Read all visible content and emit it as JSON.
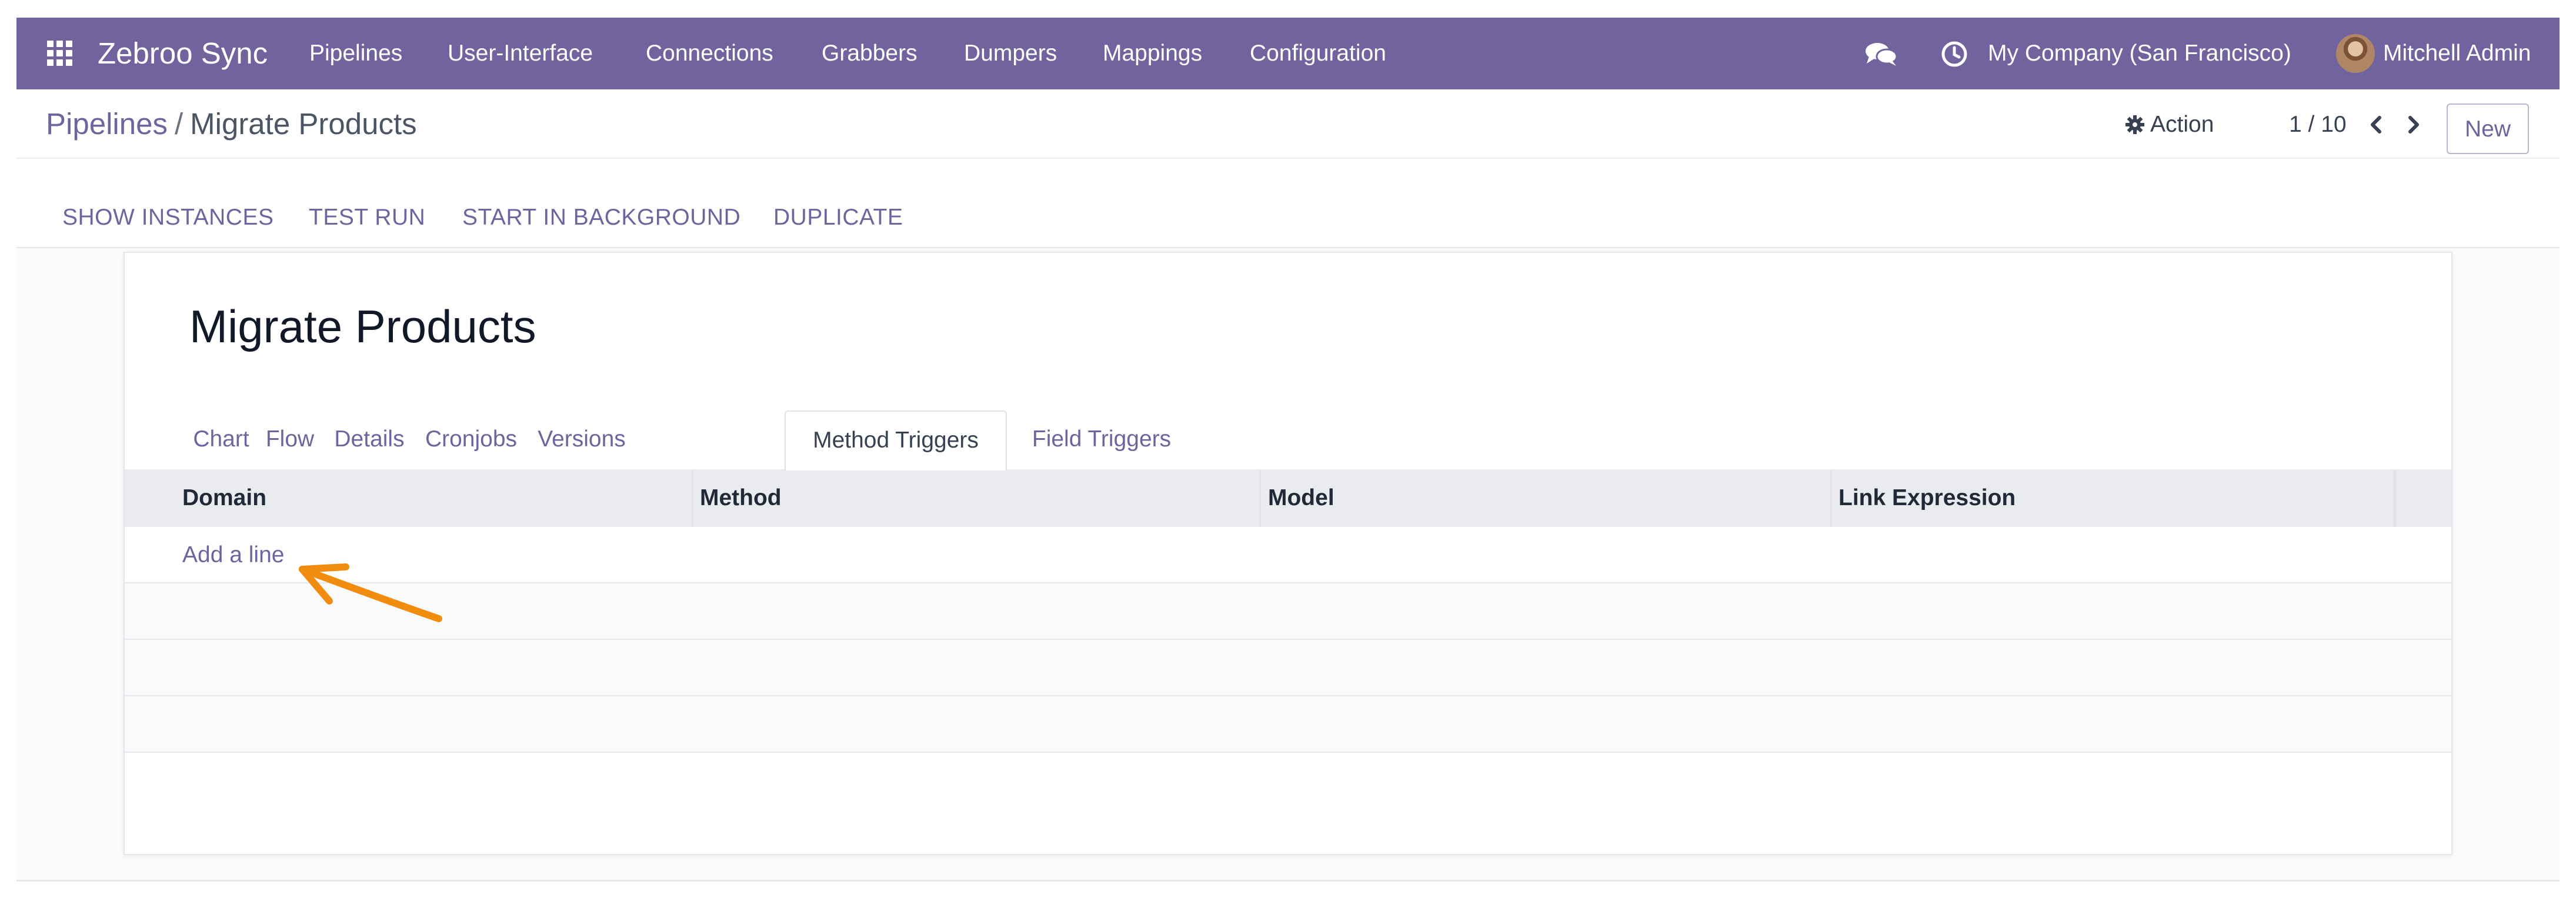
{
  "navbar": {
    "brand": "Zebroo Sync",
    "menu": [
      "Pipelines",
      "User-Interface",
      "Connections",
      "Grabbers",
      "Dumpers",
      "Mappings",
      "Configuration"
    ],
    "company": "My Company (San Francisco)",
    "user": "Mitchell Admin",
    "icons": [
      "apps-grid-icon",
      "chat-icon",
      "clock-icon"
    ]
  },
  "breadcrumb": {
    "parent": "Pipelines",
    "separator": "/",
    "current": "Migrate Products"
  },
  "control": {
    "action_label": "Action",
    "pager": "1 / 10",
    "new_label": "New"
  },
  "statusbar": {
    "buttons": [
      "SHOW INSTANCES",
      "TEST RUN",
      "START IN BACKGROUND",
      "DUPLICATE"
    ]
  },
  "record": {
    "title": "Migrate Products"
  },
  "tabs": [
    {
      "label": "Chart",
      "active": false
    },
    {
      "label": "Flow",
      "active": false
    },
    {
      "label": "Details",
      "active": false
    },
    {
      "label": "Cronjobs",
      "active": false
    },
    {
      "label": "Versions",
      "active": false
    },
    {
      "label": "Method Triggers",
      "active": true
    },
    {
      "label": "Field Triggers",
      "active": false
    }
  ],
  "table": {
    "columns": [
      "Domain",
      "Method",
      "Model",
      "Link Expression"
    ],
    "add_line": "Add a line"
  },
  "colors": {
    "brand": "#71639e",
    "annotation_arrow": "#f28c0f"
  }
}
